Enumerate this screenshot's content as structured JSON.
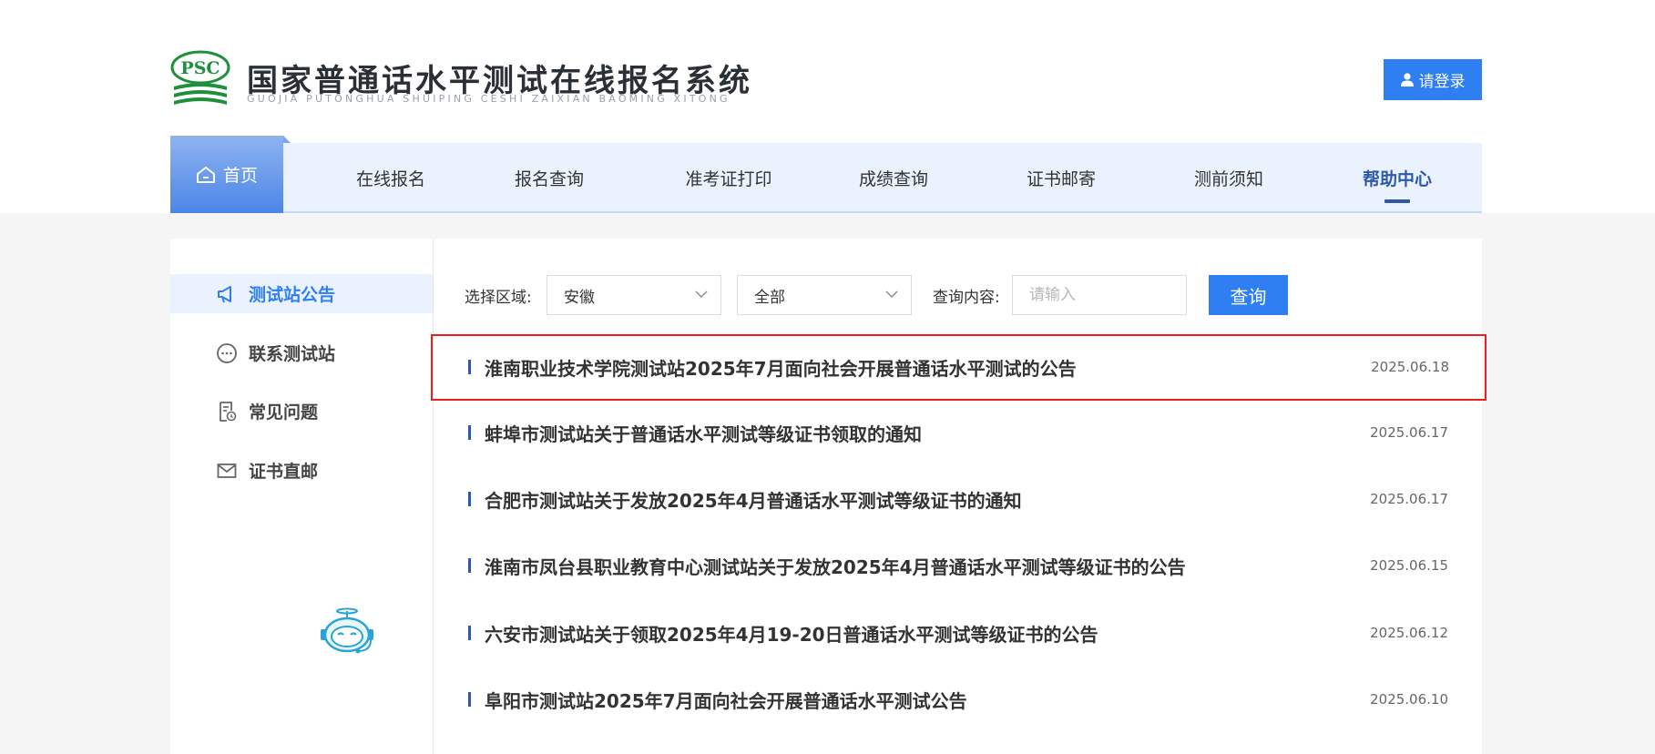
{
  "header": {
    "logo_badge": "PSC",
    "title": "国家普通话水平测试在线报名系统",
    "subtitle": "GUOJIA PUTONGHUA SHUIPING CESHI ZAIXIAN BAOMING XITONG",
    "login_label": "请登录"
  },
  "nav": {
    "items": [
      {
        "label": "首页",
        "icon": "home-icon"
      },
      {
        "label": "在线报名"
      },
      {
        "label": "报名查询"
      },
      {
        "label": "准考证打印"
      },
      {
        "label": "成绩查询"
      },
      {
        "label": "证书邮寄"
      },
      {
        "label": "测前须知"
      },
      {
        "label": "帮助中心"
      }
    ],
    "active_index": 7
  },
  "sidebar": {
    "items": [
      {
        "label": "测试站公告",
        "icon": "megaphone-icon"
      },
      {
        "label": "联系测试站",
        "icon": "chat-icon"
      },
      {
        "label": "常见问题",
        "icon": "faq-doc-icon"
      },
      {
        "label": "证书直邮",
        "icon": "mail-icon"
      }
    ],
    "active_index": 0,
    "assistant_icon": "robot-assistant-icon"
  },
  "search": {
    "region_label": "选择区域:",
    "region_value": "安徽",
    "scope_value": "全部",
    "content_label": "查询内容:",
    "content_placeholder": "请输入",
    "button_label": "查询"
  },
  "news": [
    {
      "title": "淮南职业技术学院测试站2025年7月面向社会开展普通话水平测试的公告",
      "date": "2025.06.18"
    },
    {
      "title": "蚌埠市测试站关于普通话水平测试等级证书领取的通知",
      "date": "2025.06.17"
    },
    {
      "title": "合肥市测试站关于发放2025年4月普通话水平测试等级证书的通知",
      "date": "2025.06.17"
    },
    {
      "title": "淮南市凤台县职业教育中心测试站关于发放2025年4月普通话水平测试等级证书的公告",
      "date": "2025.06.15"
    },
    {
      "title": "六安市测试站关于领取2025年4月19-20日普通话水平测试等级证书的公告",
      "date": "2025.06.12"
    },
    {
      "title": "阜阳市测试站2025年7月面向社会开展普通话水平测试公告",
      "date": "2025.06.10"
    }
  ],
  "colors": {
    "accent": "#2f7ff2",
    "nav_bg": "#eaf2fd",
    "highlight_border": "#e52124",
    "logo_green": "#1e8f3a"
  }
}
